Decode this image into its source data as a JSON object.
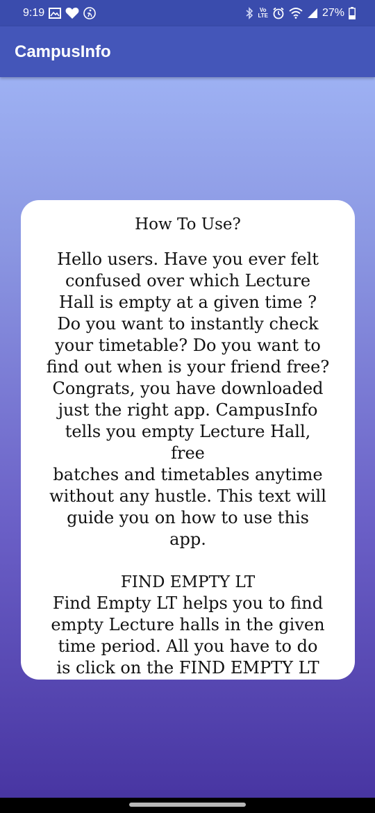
{
  "status_bar": {
    "time": "9:19",
    "battery_percent": "27%",
    "network_label_top": "Vo",
    "network_label_bottom": "LTE"
  },
  "app_bar": {
    "title": "CampusInfo"
  },
  "card": {
    "title": "How To Use?",
    "intro": "Hello users. Have you ever felt\nconfused over which Lecture\nHall is empty at a given time ?\nDo you want to instantly check\nyour timetable? Do you want to\nfind out when is your friend free?\nCongrats, you have downloaded\njust the right app. CampusInfo\ntells you empty Lecture Hall, free\nbatches and timetables anytime\nwithout any hustle. This text will\nguide you on how to use this app.",
    "section_heading": "FIND EMPTY LT",
    "section_body": "Find Empty LT helps you to find\nempty Lecture halls in the given\ntime period. All you have to do\nis click on the FIND EMPTY LT\noption. The next step involves\nchoosing the day and the time"
  },
  "colors": {
    "status_bar_bg": "#3a4cad",
    "app_bar_bg": "#4456b9",
    "gradient_top": "#a6bdfb",
    "gradient_bottom": "#4633a0",
    "card_bg": "#ffffff"
  }
}
